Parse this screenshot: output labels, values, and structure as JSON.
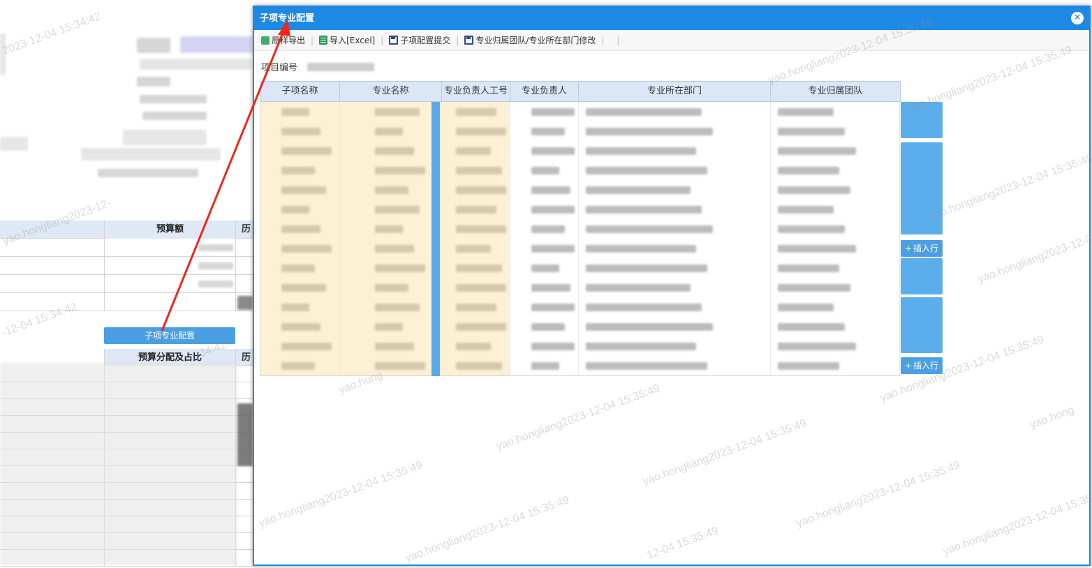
{
  "background": {
    "table1_header": "预算额",
    "table1_header_partial": "历",
    "config_button": "子项专业配置",
    "table2_header": "预算分配及占比",
    "table2_header_partial": "历"
  },
  "watermarks": [
    "2023-12-04 15:34:42",
    "yao.hongliang2023-12-",
    "-12-04 15:34:42",
    "34:42",
    "yao.hongliang2023-12-04 15:35:49",
    "yao.hong",
    "yao.hongliang2023-12-04 15:35:49",
    "yao.hongliang2023-12-04 15:35:49",
    "yao.hongliang2023-12-04 15:35:49",
    "yao.hongliang2023-12-04 15:35:49",
    "12-04 15:35:49",
    "yao.hongliang2023-12-04 15:35:49",
    "yao.hongliang2023-12-04 15:35:49",
    "yao.hongliang2023-12-04 15:35:49",
    "yao.hongliang2023-12-04 15:35:49",
    "yao.hongliang2023-12-04 15:35:49",
    "yao.hongliang2023-12-04 15:35:49",
    "yao.hong"
  ],
  "dialog": {
    "title": "子项专业配置",
    "close_glyph": "✕",
    "toolbar": [
      {
        "label": "原样导出",
        "icon": "export-icon"
      },
      {
        "label": "导入[Excel]",
        "icon": "excel-icon"
      },
      {
        "label": "子项配置提交",
        "icon": "save-icon"
      },
      {
        "label": "专业归属团队/专业所在部门修改",
        "icon": "save-icon"
      }
    ],
    "project_label": "项目编号",
    "columns": [
      "子项名称",
      "专业名称",
      "专业负责人工号",
      "专业负责人",
      "专业所在部门",
      "专业归属团队"
    ],
    "insert_row_label": "插入行"
  }
}
